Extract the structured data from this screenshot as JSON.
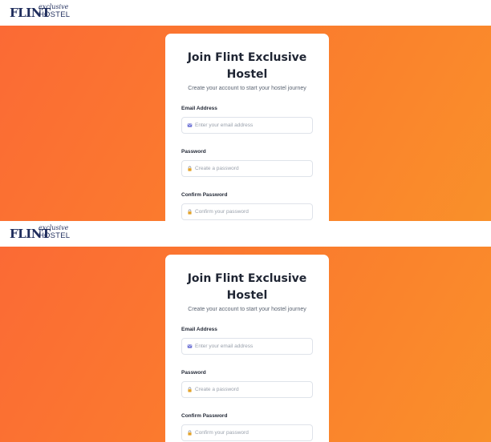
{
  "brand": {
    "logo_main": "FLINT",
    "logo_script": "exclusive",
    "logo_sub": "HOSTEL"
  },
  "signup": {
    "title": "Join Flint Exclusive Hostel",
    "subtitle": "Create your account to start your hostel journey",
    "fields": [
      {
        "label": "Email Address",
        "placeholder": "Enter your email address",
        "icon": "mail-icon"
      },
      {
        "label": "Password",
        "placeholder": "Create a password",
        "icon": "lock-icon"
      },
      {
        "label": "Confirm Password",
        "placeholder": "Confirm your password",
        "icon": "lock-icon"
      }
    ]
  },
  "colors": {
    "brand_navy": "#1f2d5c",
    "hero_gradient_start": "#fb6a35",
    "hero_gradient_end": "#f9902a",
    "mail_icon": "#6a6fd4",
    "lock_icon": "#e3a229"
  }
}
